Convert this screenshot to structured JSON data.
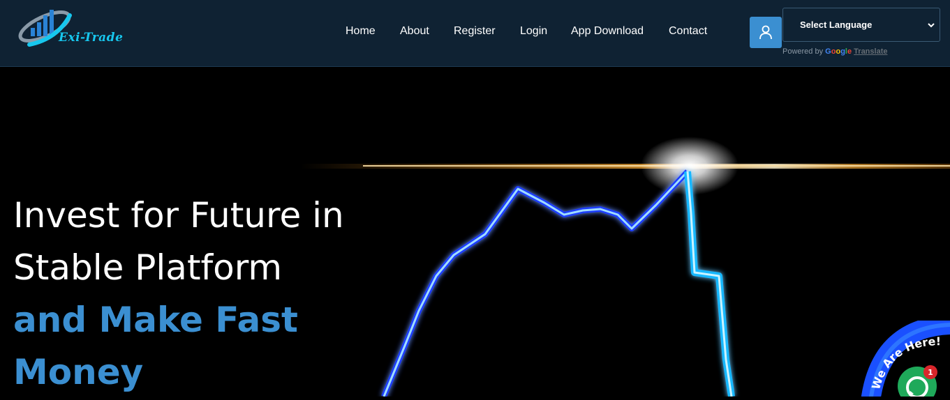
{
  "brand": {
    "name": "Exi-Trade"
  },
  "nav": {
    "items": [
      {
        "label": "Home"
      },
      {
        "label": "About"
      },
      {
        "label": "Register"
      },
      {
        "label": "Login"
      },
      {
        "label": "App Download"
      },
      {
        "label": "Contact"
      }
    ]
  },
  "language": {
    "selected": "Select Language",
    "powered_by": "Powered by",
    "google": "Google",
    "translate": "Translate"
  },
  "hero": {
    "line1": "Invest for Future in",
    "line2": "Stable Platform",
    "line3": "and Make Fast",
    "line4": "Money"
  },
  "chat": {
    "label": "We Are Here!",
    "unread_count": "1"
  },
  "colors": {
    "header_bg": "#0f2233",
    "accent": "#3b8fd1",
    "brand_cyan": "#17c7ee",
    "badge_red": "#d9262b",
    "chat_green": "#1fa95a"
  },
  "icons": [
    "logo-icon",
    "user-icon",
    "chevron-down-icon",
    "chat-icon"
  ]
}
